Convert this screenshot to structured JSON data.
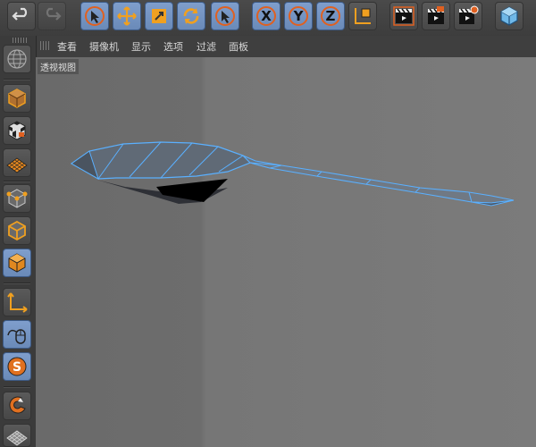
{
  "toolbar": {
    "buttons": [
      {
        "name": "undo-button",
        "icon": "undo-arrow-icon"
      },
      {
        "name": "redo-button",
        "icon": "redo-arrow-icon"
      },
      {
        "name": "live-selection-button",
        "icon": "cursor-arrow-icon"
      },
      {
        "name": "move-tool-button",
        "icon": "move-cross-icon"
      },
      {
        "name": "scale-tool-button",
        "icon": "scale-square-icon"
      },
      {
        "name": "rotate-tool-button",
        "icon": "rotate-arrows-icon"
      },
      {
        "name": "last-tool-button",
        "icon": "cursor-arrow-icon"
      },
      {
        "name": "x-axis-lock-button",
        "icon": "x-letter-icon"
      },
      {
        "name": "y-axis-lock-button",
        "icon": "y-letter-icon"
      },
      {
        "name": "z-axis-lock-button",
        "icon": "z-letter-icon"
      },
      {
        "name": "coordinate-system-button",
        "icon": "axes-cube-icon"
      },
      {
        "name": "render-view-button",
        "icon": "clapper-icon"
      },
      {
        "name": "render-picture-viewer-button",
        "icon": "clapper-icon"
      },
      {
        "name": "render-settings-button",
        "icon": "clapper-gear-icon"
      },
      {
        "name": "cube-object-button",
        "icon": "cube-icon"
      }
    ],
    "axis_labels": {
      "x": "X",
      "y": "Y",
      "z": "Z"
    }
  },
  "menubar": {
    "items": [
      "查看",
      "摄像机",
      "显示",
      "选项",
      "过滤",
      "面板"
    ]
  },
  "viewport": {
    "label": "透视视图"
  },
  "sidebar": {
    "buttons": [
      {
        "name": "sphere-grid-icon"
      },
      {
        "name": "model-mode-icon"
      },
      {
        "name": "texture-mode-icon"
      },
      {
        "name": "workplane-icon"
      },
      {
        "name": "points-mode-icon"
      },
      {
        "name": "edges-mode-icon"
      },
      {
        "name": "polygons-mode-icon"
      },
      {
        "name": "axis-mode-icon"
      },
      {
        "name": "tweak-mode-icon"
      },
      {
        "name": "snap-icon"
      },
      {
        "name": "magnet-icon"
      },
      {
        "name": "floor-grid-icon"
      }
    ]
  },
  "colors": {
    "accent_orange": "#f0a020",
    "selected_blue": "#7f9ecc",
    "mesh_edge": "#5ab0ff",
    "mesh_face": "#58606a"
  }
}
